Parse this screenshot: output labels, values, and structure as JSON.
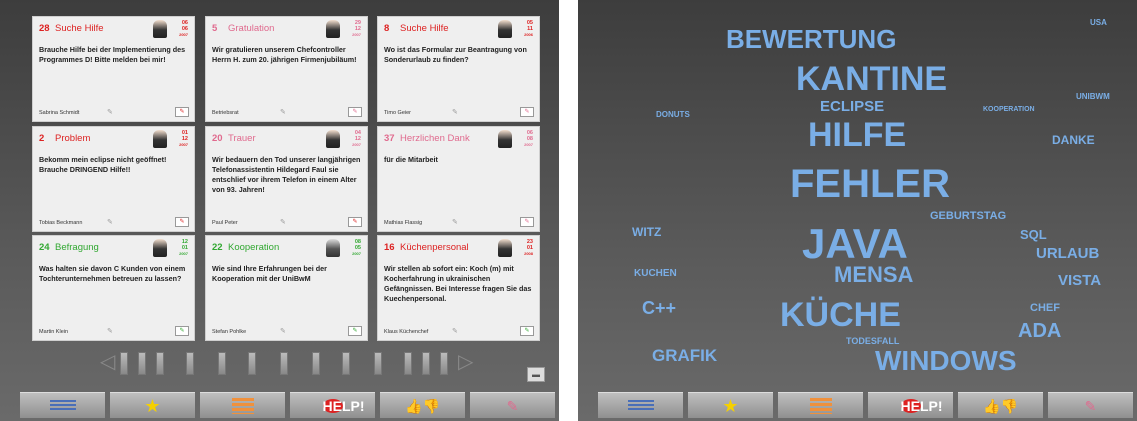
{
  "cards": [
    {
      "num": "28",
      "title": "Suche Hilfe",
      "color": "red",
      "date": [
        "06",
        "06",
        "2007"
      ],
      "body": "Brauche Hilfe bei der Implementierung des Programmes D! Bitte melden bei mir!",
      "author": "Sabrina Schmidt"
    },
    {
      "num": "5",
      "title": "Gratulation",
      "color": "pink",
      "date": [
        "29",
        "12",
        "2007"
      ],
      "body": "Wir gratulieren unserem Chefcontroller Herrn H. zum 20. jährigen Firmenjubiläum!",
      "author": "Betriebsrat"
    },
    {
      "num": "8",
      "title": "Suche Hilfe",
      "color": "red",
      "date": [
        "05",
        "11",
        "2006"
      ],
      "body": "Wo ist das Formular zur Beantragung von Sonderurlaub zu finden?",
      "author": "Timo Geier"
    },
    {
      "num": "2",
      "title": "Problem",
      "color": "red",
      "date": [
        "01",
        "12",
        "2007"
      ],
      "body": "Bekomm mein eclipse nicht geöffnet! Brauche DRINGEND Hilfe!!",
      "author": "Tobias Beckmann"
    },
    {
      "num": "20",
      "title": "Trauer",
      "color": "pink",
      "date": [
        "04",
        "12",
        "2007"
      ],
      "body": "Wir bedauern den Tod unserer langjährigen Telefonassistentin Hildegard Faul sie entschlief vor ihrem Telefon in einem Alter von 93. Jahren!",
      "author": "Paul Peter"
    },
    {
      "num": "37",
      "title": "Herzlichen Dank",
      "color": "pink",
      "date": [
        "06",
        "08",
        "2007"
      ],
      "body": "für die Mitarbeit",
      "author": "Mathias Flassig"
    },
    {
      "num": "24",
      "title": "Befragung",
      "color": "green",
      "date": [
        "12",
        "01",
        "2007"
      ],
      "body": "Was halten sie davon C Kunden von einem Tochterunternehmen betreuen zu lassen?",
      "author": "Martin Klein"
    },
    {
      "num": "22",
      "title": "Kooperation",
      "color": "green",
      "date": [
        "08",
        "05",
        "2007"
      ],
      "body": "Wie sind Ihre Erfahrungen bei der Kooperation mit der UniBwM",
      "author": "Stefan Pohlke"
    },
    {
      "num": "16",
      "title": "Küchenpersonal",
      "color": "red",
      "date": [
        "23",
        "01",
        "2008"
      ],
      "body": "Wir stellen ab sofort ein: Koch (m) mit Kocherfahrung in ukrainischen Gefängnissen. Bei Interesse fragen Sie das Kuechenpersonal.",
      "author": "Klaus Küchenchef"
    }
  ],
  "toolbar": {
    "help_label": "HELP!",
    "icons": [
      "list-icon",
      "star-icon",
      "bar-chart-icon",
      "help-icon",
      "thumbs-icon",
      "pen-icon"
    ]
  },
  "wordcloud": [
    {
      "text": "BEWERTUNG",
      "size": 26
    },
    {
      "text": "USA",
      "size": 8
    },
    {
      "text": "KANTINE",
      "size": 34
    },
    {
      "text": "ECLIPSE",
      "size": 15
    },
    {
      "text": "UNIBWM",
      "size": 8
    },
    {
      "text": "DONUTS",
      "size": 8
    },
    {
      "text": "KOOPERATION",
      "size": 7
    },
    {
      "text": "HILFE",
      "size": 34
    },
    {
      "text": "DANKE",
      "size": 12
    },
    {
      "text": "FEHLER",
      "size": 40
    },
    {
      "text": "GEBURTSTAG",
      "size": 11
    },
    {
      "text": "WITZ",
      "size": 12
    },
    {
      "text": "JAVA",
      "size": 42
    },
    {
      "text": "SQL",
      "size": 13
    },
    {
      "text": "URLAUB",
      "size": 15
    },
    {
      "text": "MENSA",
      "size": 22
    },
    {
      "text": "KUCHEN",
      "size": 10
    },
    {
      "text": "VISTA",
      "size": 15
    },
    {
      "text": "C++",
      "size": 18
    },
    {
      "text": "KÜCHE",
      "size": 34
    },
    {
      "text": "CHEF",
      "size": 11
    },
    {
      "text": "ADA",
      "size": 20
    },
    {
      "text": "TODESFALL",
      "size": 9
    },
    {
      "text": "GRAFIK",
      "size": 17
    },
    {
      "text": "WINDOWS",
      "size": 28
    }
  ],
  "colors": {
    "red": "#d22222",
    "pink": "#e06a8e",
    "green": "#32a832",
    "cloud": "#7aaee6"
  }
}
